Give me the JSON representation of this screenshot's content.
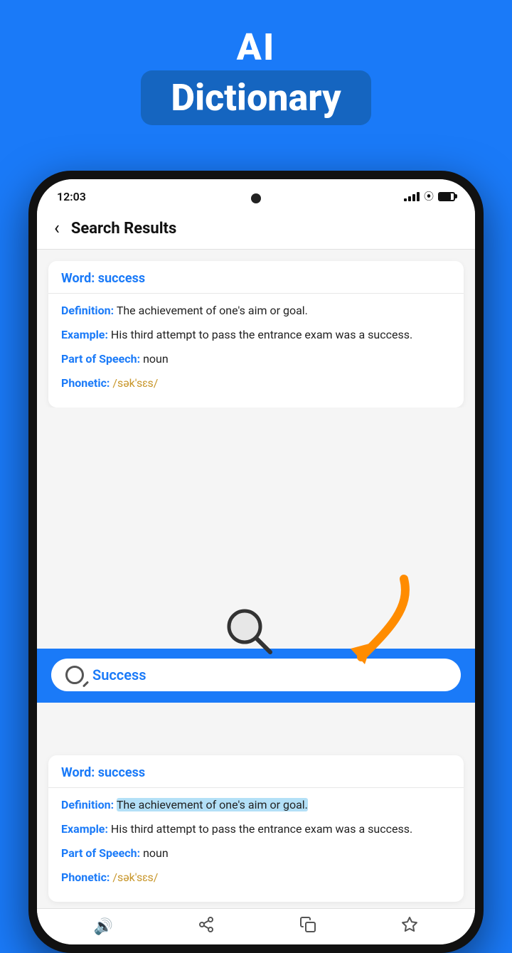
{
  "header": {
    "ai_label": "AI",
    "dictionary_badge": "Dictionary",
    "background_color": "#1a7af8"
  },
  "status_bar": {
    "time": "12:03",
    "signal_bars": 4,
    "wifi": true,
    "battery_level": "80%"
  },
  "nav": {
    "back_icon": "‹",
    "title": "Search Results"
  },
  "search_bar": {
    "value": "Success",
    "placeholder": "Search"
  },
  "word_card_top": {
    "word_label": "Word:",
    "word_value": "success",
    "definition_label": "Definition:",
    "definition_value": " The achievement of one's aim or goal.",
    "example_label": "Example:",
    "example_value": " His third attempt to pass the entrance exam was a success.",
    "pos_label": "Part of Speech:",
    "pos_value": "  noun",
    "phonetic_label": "Phonetic:",
    "phonetic_value": " /sək'sɛs/"
  },
  "word_card_bottom": {
    "word_label": "Word:",
    "word_value": "success",
    "definition_label": "Definition:",
    "definition_value_highlighted": "The achievement of one's aim or goal.",
    "example_label": "Example:",
    "example_value": " His third attempt to pass the entrance exam was a success.",
    "pos_label": "Part of Speech:",
    "pos_value": "  noun",
    "phonetic_label": "Phonetic:",
    "phonetic_value": " /sək'sɛs/"
  },
  "action_bar": {
    "speaker_icon": "🔊",
    "share_icon": "share",
    "copy_icon": "copy",
    "star_icon": "★"
  }
}
